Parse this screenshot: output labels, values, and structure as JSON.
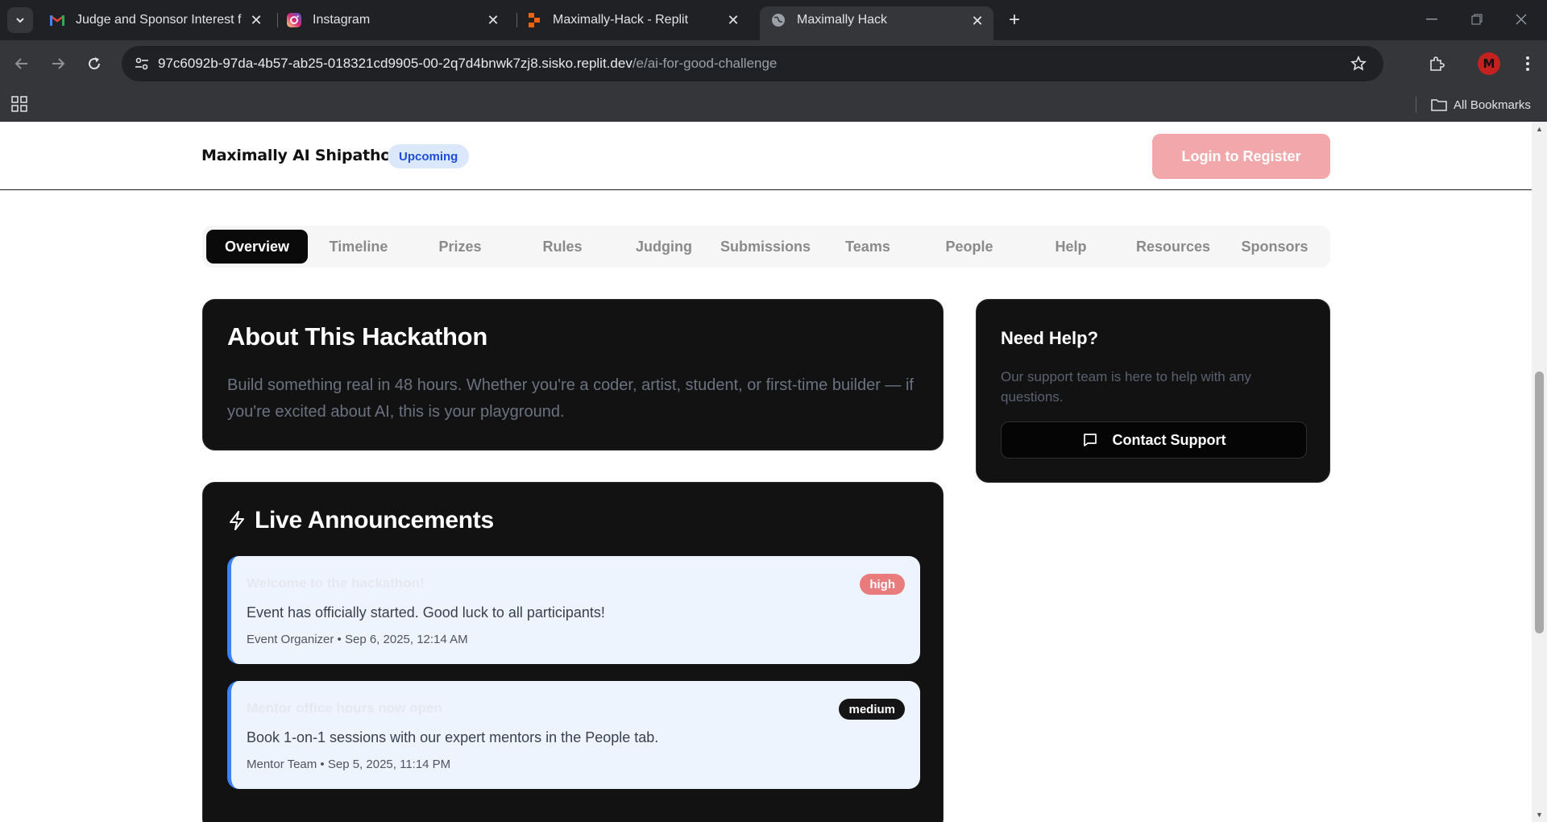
{
  "browser": {
    "tabs": [
      {
        "title": "Judge and Sponsor Interest for",
        "favicon": "gmail-icon"
      },
      {
        "title": "Instagram",
        "favicon": "instagram-icon"
      },
      {
        "title": "Maximally-Hack - Replit",
        "favicon": "replit-icon"
      },
      {
        "title": "Maximally Hack",
        "favicon": "globe-icon",
        "active": true
      }
    ],
    "url_host": "97c6092b-97da-4b57-ab25-018321cd9905-00-2q7d4bnwk7zj8.sisko.replit.dev",
    "url_path": "/e/ai-for-good-challenge",
    "profile_initial": "M",
    "all_bookmarks": "All Bookmarks"
  },
  "header": {
    "brand": "Maximally AI Shipathon",
    "status": "Upcoming",
    "login_button": "Login to Register"
  },
  "nav_tabs": [
    "Overview",
    "Timeline",
    "Prizes",
    "Rules",
    "Judging",
    "Submissions",
    "Teams",
    "People",
    "Help",
    "Resources",
    "Sponsors"
  ],
  "active_tab": "Overview",
  "about": {
    "title": "About This Hackathon",
    "description": "Build something real in 48 hours. Whether you're a coder, artist, student, or first-time builder — if you're excited about AI, this is your playground."
  },
  "help": {
    "title": "Need Help?",
    "description": "Our support team is here to help with any questions.",
    "button": "Contact Support"
  },
  "announcements": {
    "title": "Live Announcements",
    "items": [
      {
        "title": "Welcome to the hackathon!",
        "body": "Event has officially started. Good luck to all participants!",
        "meta": "Event Organizer • Sep 6, 2025, 12:14 AM",
        "priority": "high"
      },
      {
        "title": "Mentor office hours now open",
        "body": "Book 1-on-1 sessions with our expert mentors in the People tab.",
        "meta": "Mentor Team • Sep 5, 2025, 11:14 PM",
        "priority": "medium"
      }
    ]
  },
  "colors": {
    "accent_dark": "#0a0a0a",
    "login_pink": "#f2a8aa",
    "status_blue": "#1d4ed8",
    "announcement_border": "#3b82f6",
    "priority_high": "#e87b7b"
  }
}
